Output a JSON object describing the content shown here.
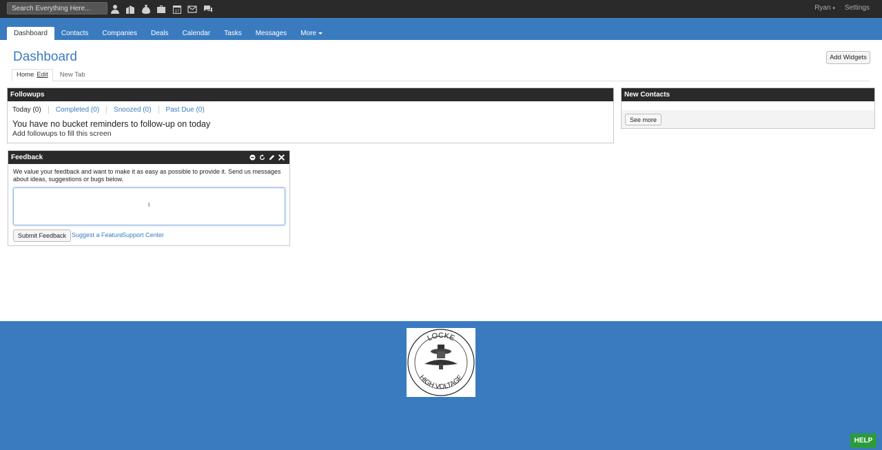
{
  "topbar": {
    "search_placeholder": "Search Everything Here...",
    "icons": [
      "person-icon",
      "building-icon",
      "money-bag-icon",
      "briefcase-icon",
      "calendar-icon",
      "envelope-icon",
      "chat-icon"
    ],
    "calendar_day": "17",
    "user": "Ryan",
    "settings": "Settings"
  },
  "nav": {
    "tabs": [
      {
        "label": "Dashboard",
        "active": true
      },
      {
        "label": "Contacts"
      },
      {
        "label": "Companies"
      },
      {
        "label": "Deals"
      },
      {
        "label": "Calendar"
      },
      {
        "label": "Tasks"
      },
      {
        "label": "Messages"
      },
      {
        "label": "More"
      }
    ]
  },
  "page": {
    "title": "Dashboard",
    "add_widgets": "Add Widgets",
    "subtabs": {
      "home": "Home",
      "edit": "Edit",
      "new_tab": "New Tab"
    }
  },
  "followups": {
    "title": "Followups",
    "tabs": [
      "Today (0)",
      "Completed (0)",
      "Snoozed (0)",
      "Past Due (0)"
    ],
    "message": "You have no bucket reminders to follow-up on today",
    "sub": "Add followups to fill this screen"
  },
  "new_contacts": {
    "title": "New Contacts",
    "see_more": "See more"
  },
  "feedback": {
    "title": "Feedback",
    "text": "We value your feedback and want to make it as easy as possible to provide it. Send us messages about ideas, suggestions or bugs below.",
    "submit": "Submit Feedback",
    "suggest": "Suggest a Feature",
    "support": "Support Center"
  },
  "footer": {
    "logo_top": "LOCKE",
    "logo_bottom": "HIGH VOLTAGE",
    "help": "HELP"
  },
  "colors": {
    "brand_blue": "#3a7bbf",
    "dark": "#2a2a2a",
    "help_green": "#2c9b3b"
  }
}
